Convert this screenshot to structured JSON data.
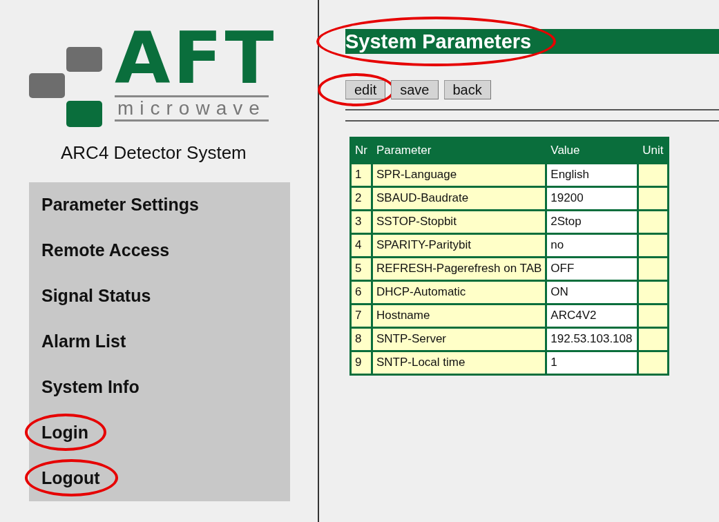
{
  "logo": {
    "wordmark": "AFT",
    "tagline": "microwave"
  },
  "system_name": "ARC4 Detector System",
  "menu": [
    {
      "label": "Parameter Settings",
      "circled": false
    },
    {
      "label": "Remote Access",
      "circled": false
    },
    {
      "label": "Signal Status",
      "circled": false
    },
    {
      "label": "Alarm List",
      "circled": false
    },
    {
      "label": "System Info",
      "circled": false
    },
    {
      "label": "Login",
      "circled": true
    },
    {
      "label": "Logout",
      "circled": true
    }
  ],
  "page_title": {
    "text": "System Parameters",
    "circled": true
  },
  "buttons": [
    {
      "label": "edit",
      "circled": true
    },
    {
      "label": "save",
      "circled": false
    },
    {
      "label": "back",
      "circled": false
    }
  ],
  "table": {
    "columns": [
      "Nr",
      "Parameter",
      "Value",
      "Unit"
    ],
    "rows": [
      {
        "nr": "1",
        "parameter": "SPR-Language",
        "value": "English"
      },
      {
        "nr": "2",
        "parameter": "SBAUD-Baudrate",
        "value": "19200"
      },
      {
        "nr": "3",
        "parameter": "SSTOP-Stopbit",
        "value": "2Stop"
      },
      {
        "nr": "4",
        "parameter": "SPARITY-Paritybit",
        "value": "no"
      },
      {
        "nr": "5",
        "parameter": "REFRESH-Pagerefresh on TAB",
        "value": "OFF"
      },
      {
        "nr": "6",
        "parameter": "DHCP-Automatic",
        "value": "ON"
      },
      {
        "nr": "7",
        "parameter": "Hostname",
        "value": "ARC4V2"
      },
      {
        "nr": "8",
        "parameter": "SNTP-Server",
        "value": "192.53.103.108"
      },
      {
        "nr": "9",
        "parameter": "SNTP-Local time",
        "value": "1"
      }
    ]
  }
}
